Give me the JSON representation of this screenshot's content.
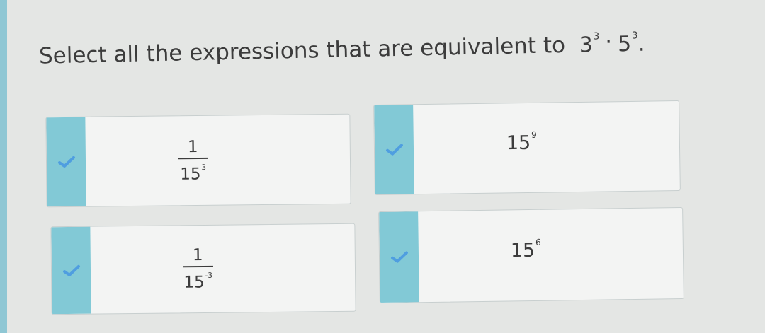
{
  "prompt": {
    "text": "Select all the expressions that are equivalent to",
    "expr_base1": "3",
    "expr_exp1": "3",
    "expr_dot": "·",
    "expr_base2": "5",
    "expr_exp2": "3",
    "expr_end": "."
  },
  "options": [
    {
      "type": "fraction",
      "numerator": "1",
      "base": "15",
      "exponent": "3",
      "checked": true
    },
    {
      "type": "power",
      "base": "15",
      "exponent": "9",
      "checked": true
    },
    {
      "type": "fraction",
      "numerator": "1",
      "base": "15",
      "exponent": "-3",
      "checked": true
    },
    {
      "type": "power",
      "base": "15",
      "exponent": "6",
      "checked": true
    }
  ],
  "colors": {
    "check_panel": "#82c9d6",
    "checkmark": "#4f9ee0",
    "background": "#e4e6e4",
    "option_bg": "#f3f4f3",
    "text": "#3c3c3c"
  },
  "icons": {
    "check": "checkmark-icon"
  }
}
